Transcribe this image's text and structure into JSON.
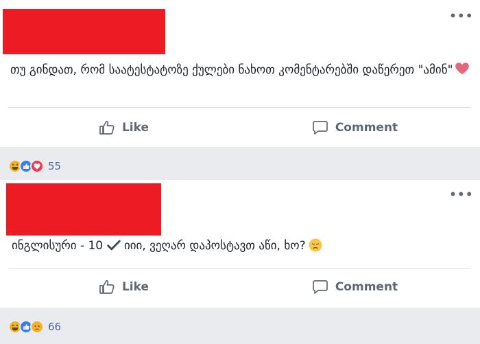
{
  "posts": [
    {
      "text": "თუ გინდათ, რომ საატესტატოზე ქულები ნახოთ კომენტარებში დაწერეთ \"ამინ\"",
      "actions": {
        "like_label": "Like",
        "comment_label": "Comment"
      },
      "reactions": {
        "icons": [
          "haha-icon",
          "like-icon",
          "love-icon"
        ],
        "count": "55"
      },
      "emoji": "heart-icon"
    },
    {
      "text_before": "ინგლისური - 10",
      "text_after": "იიი, ვეღარ დაპოსტავთ აწი, ხო?",
      "actions": {
        "like_label": "Like",
        "comment_label": "Comment"
      },
      "reactions": {
        "icons": [
          "haha-icon",
          "like-icon",
          "sad-icon"
        ],
        "count": "66"
      },
      "emoji": "disappointed-face-icon"
    }
  ],
  "colors": {
    "redaction": "#ed1c24",
    "feed_bg": "#e9ebee",
    "action_text": "#606770",
    "count_text": "#4b67a1"
  }
}
